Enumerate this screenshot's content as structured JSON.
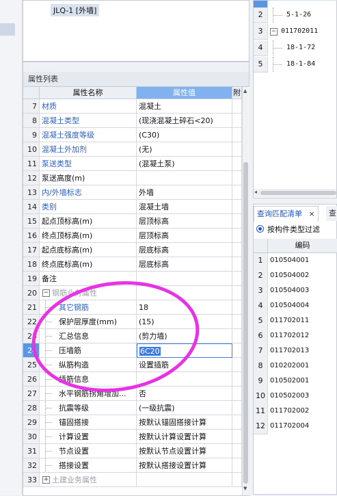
{
  "tree": {
    "node": "JLQ-1 [外墙]"
  },
  "props": {
    "title": "属性列表",
    "headers": {
      "name": "属性名称",
      "value": "属性值",
      "extra": "附"
    },
    "rows": [
      {
        "n": "7",
        "name": "材质",
        "value": "混凝土",
        "style": "blue"
      },
      {
        "n": "8",
        "name": "混凝土类型",
        "value": "(现浇混凝土碎石<20)",
        "style": "blue"
      },
      {
        "n": "9",
        "name": "混凝土强度等级",
        "value": "(C30)",
        "style": "blue"
      },
      {
        "n": "10",
        "name": "混凝土外加剂",
        "value": "(无)",
        "style": "blue"
      },
      {
        "n": "11",
        "name": "泵送类型",
        "value": "(混凝土泵)",
        "style": "blue"
      },
      {
        "n": "12",
        "name": "泵送高度(m)",
        "value": "",
        "style": ""
      },
      {
        "n": "13",
        "name": "内/外墙标志",
        "value": "外墙",
        "style": "blue"
      },
      {
        "n": "14",
        "name": "类别",
        "value": "混凝土墙",
        "style": "blue"
      },
      {
        "n": "15",
        "name": "起点顶标高(m)",
        "value": "层顶标高",
        "style": ""
      },
      {
        "n": "16",
        "name": "终点顶标高(m)",
        "value": "层顶标高",
        "style": ""
      },
      {
        "n": "17",
        "name": "起点底标高(m)",
        "value": "层底标高",
        "style": ""
      },
      {
        "n": "18",
        "name": "终点底标高(m)",
        "value": "层底标高",
        "style": ""
      },
      {
        "n": "19",
        "name": "备注",
        "value": "",
        "style": ""
      },
      {
        "n": "20",
        "name": "钢筋业务属性",
        "value": "",
        "style": "group"
      },
      {
        "n": "21",
        "name": "其它钢筋",
        "value": "18",
        "style": "child-blue"
      },
      {
        "n": "22",
        "name": "保护层厚度(mm)",
        "value": "(15)",
        "style": "child"
      },
      {
        "n": "23",
        "name": "汇总信息",
        "value": "(剪力墙)",
        "style": "child"
      },
      {
        "n": "24",
        "name": "压墙筋",
        "value": "6C20",
        "style": "child-edit"
      },
      {
        "n": "25",
        "name": "纵筋构造",
        "value": "设置插筋",
        "style": "child"
      },
      {
        "n": "26",
        "name": "插筋信息",
        "value": "",
        "style": "child"
      },
      {
        "n": "27",
        "name": "水平钢筋拐角增加...",
        "value": "否",
        "style": "child"
      },
      {
        "n": "28",
        "name": "抗震等级",
        "value": "(一级抗震)",
        "style": "child"
      },
      {
        "n": "29",
        "name": "锚固搭接",
        "value": "按默认锚固搭接计算",
        "style": "childplus"
      },
      {
        "n": "30",
        "name": "计算设置",
        "value": "按默认计算设置计算",
        "style": "childplus"
      },
      {
        "n": "31",
        "name": "节点设置",
        "value": "按默认节点设置计算",
        "style": "childplus"
      },
      {
        "n": "32",
        "name": "搭接设置",
        "value": "按默认搭接设置计算",
        "style": "childplus"
      },
      {
        "n": "33",
        "name": "土建业务属性",
        "value": "",
        "style": "groupplus"
      }
    ]
  },
  "rightTop": {
    "rows": [
      {
        "n": "2",
        "text": "5-1-26"
      },
      {
        "n": "3",
        "text": "011702011"
      },
      {
        "n": "4",
        "text": "18-1-72"
      },
      {
        "n": "5",
        "text": "18-1-84"
      }
    ]
  },
  "rightBottom": {
    "tab_active": "查询匹配清单",
    "tab_close": "×",
    "tab_other": "查",
    "filter_label": "按构件类型过滤",
    "header": "编码",
    "rows": [
      {
        "n": "1",
        "code": "010504001"
      },
      {
        "n": "2",
        "code": "010504002"
      },
      {
        "n": "3",
        "code": "010504003"
      },
      {
        "n": "4",
        "code": "010504004"
      },
      {
        "n": "5",
        "code": "011702011"
      },
      {
        "n": "6",
        "code": "011702012"
      },
      {
        "n": "7",
        "code": "011702013"
      },
      {
        "n": "8",
        "code": "010202001"
      },
      {
        "n": "9",
        "code": "010502001"
      },
      {
        "n": "10",
        "code": "010502003"
      },
      {
        "n": "11",
        "code": "011702002"
      },
      {
        "n": "12",
        "code": "011702004"
      }
    ]
  },
  "colors": {
    "accent": "#7fb2ee",
    "selected": "#5a95e0",
    "annotation": "#e733e3",
    "link": "#2a5fc6"
  }
}
